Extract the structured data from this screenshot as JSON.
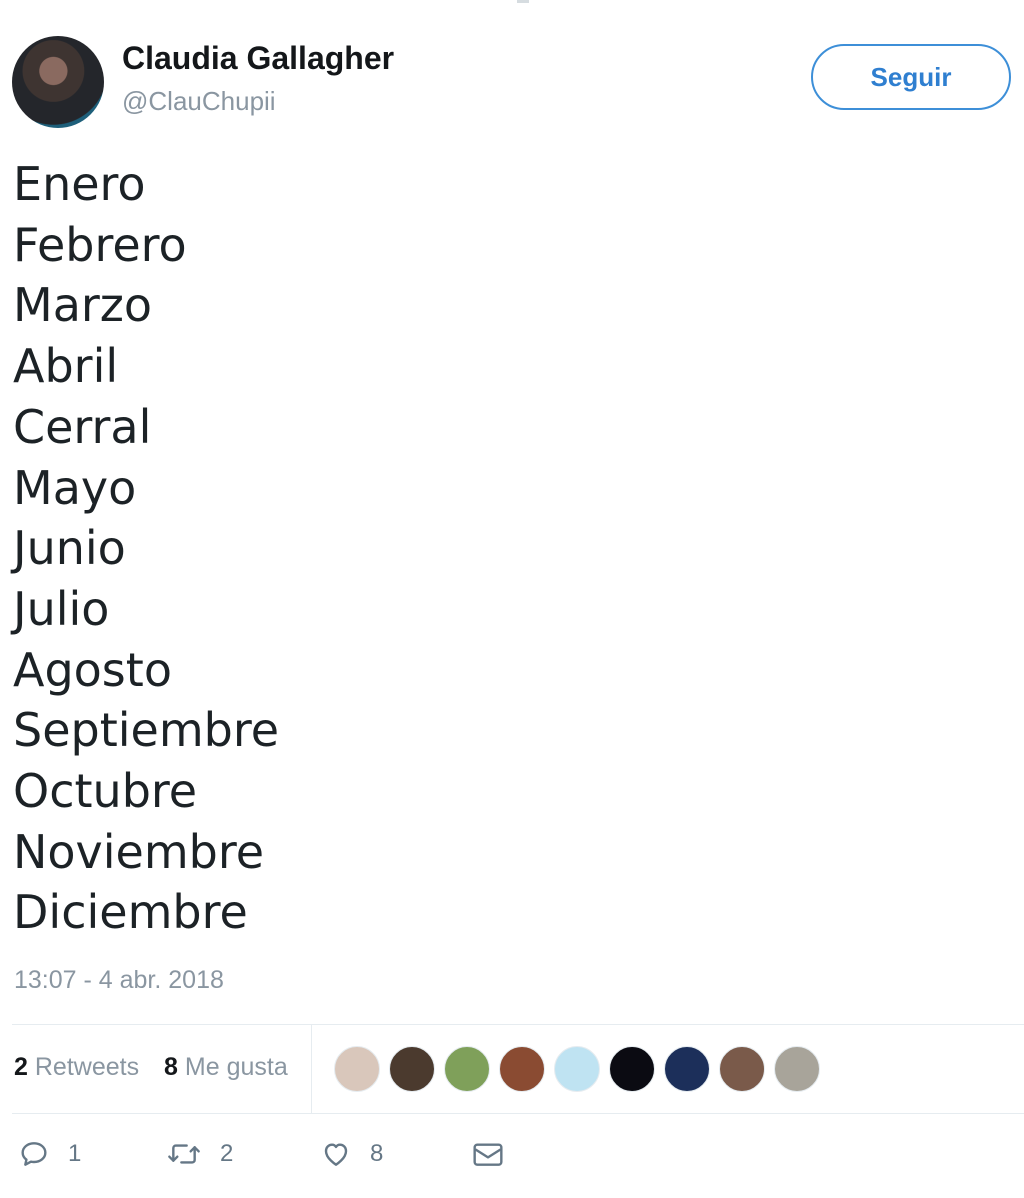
{
  "user": {
    "display_name": "Claudia Gallagher",
    "handle": "@ClauChupii",
    "follow_label": "Seguir"
  },
  "tweet": {
    "lines": [
      "Enero",
      "Febrero",
      "Marzo",
      "Abril",
      "Cerral",
      "Mayo",
      "Junio",
      "Julio",
      "Agosto",
      "Septiembre",
      "Octubre",
      "Noviembre",
      "Diciembre"
    ],
    "timestamp": "13:07 - 4 abr. 2018"
  },
  "stats": {
    "retweets_count": "2",
    "retweets_label": "Retweets",
    "likes_count": "8",
    "likes_label": "Me gusta"
  },
  "likers": [
    {
      "color": "#d9c7bb"
    },
    {
      "color": "#4b3a2e"
    },
    {
      "color": "#7fa05a"
    },
    {
      "color": "#8a4b32"
    },
    {
      "color": "#bfe3f2"
    },
    {
      "color": "#0b0b12"
    },
    {
      "color": "#1c2f5a"
    },
    {
      "color": "#7a5a4a"
    },
    {
      "color": "#a8a49a"
    }
  ],
  "actions": {
    "reply": {
      "icon": "reply-icon",
      "count": "1"
    },
    "retweet": {
      "icon": "retweet-icon",
      "count": "2"
    },
    "like": {
      "icon": "heart-icon",
      "count": "8"
    },
    "message": {
      "icon": "envelope-icon"
    }
  },
  "colors": {
    "accent": "#2f7fd0",
    "muted": "#8a96a1",
    "text": "#14171a"
  }
}
